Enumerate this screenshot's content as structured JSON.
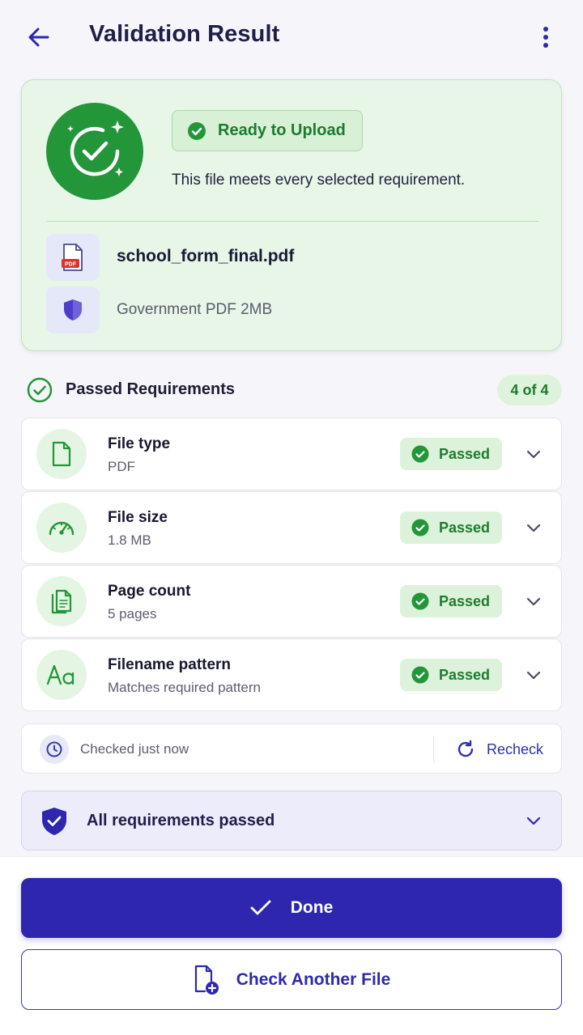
{
  "header": {
    "title": "Validation Result",
    "back_icon": "arrow-left-icon",
    "more_icon": "more-vertical-icon"
  },
  "result": {
    "status_label": "Ready to Upload",
    "description": "This file meets every selected requirement.",
    "file_name": "school_form_final.pdf",
    "file_badge": "PDF",
    "profile": "Government PDF 2MB",
    "accent": "#23963a"
  },
  "requirements": {
    "title": "Passed Requirements",
    "count": "4 of 4",
    "items": [
      {
        "title": "File type",
        "value": "PDF",
        "status": "Passed",
        "icon": "document-icon"
      },
      {
        "title": "File size",
        "value": "1.8 MB",
        "status": "Passed",
        "icon": "gauge-icon"
      },
      {
        "title": "Page count",
        "value": "5 pages",
        "status": "Passed",
        "icon": "pages-icon"
      },
      {
        "title": "Filename pattern",
        "value": "Matches required pattern",
        "status": "Passed",
        "icon": "text-aa-icon"
      }
    ]
  },
  "checked": {
    "text": "Checked just now",
    "recheck_label": "Recheck"
  },
  "summary": {
    "label": "All requirements passed"
  },
  "actions": {
    "done_label": "Done",
    "another_label": "Check Another File"
  },
  "colors": {
    "primary": "#2f26b0",
    "success": "#1f7c30",
    "success_bg": "#dcf2da"
  }
}
